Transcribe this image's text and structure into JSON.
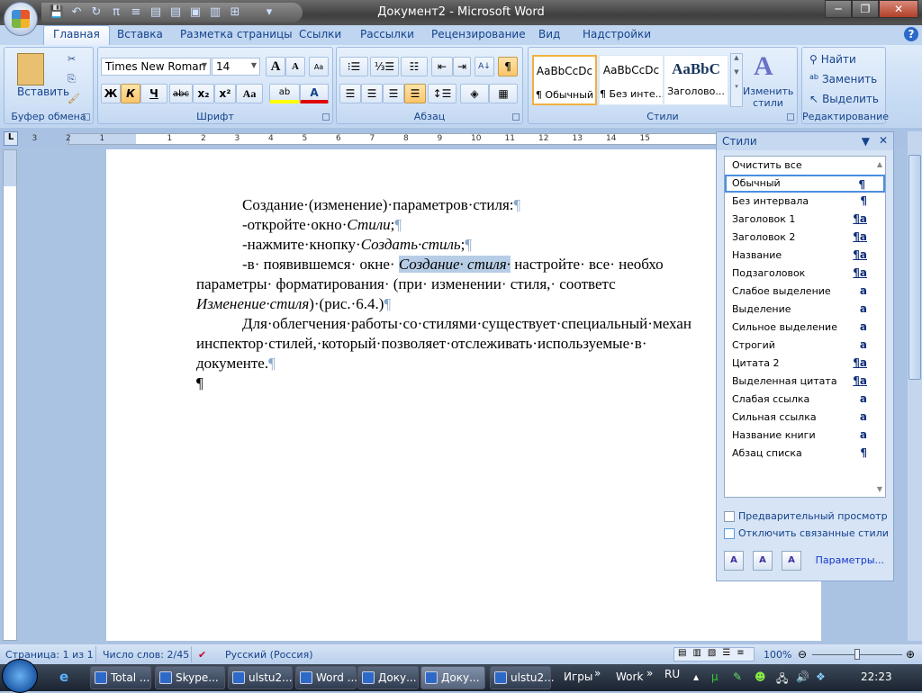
{
  "window": {
    "title": "Документ2 - Microsoft Word",
    "minimize": "─",
    "restore": "❐",
    "close": "✕"
  },
  "qat": [
    "save-icon",
    "undo-icon",
    "redo-icon",
    "pi-icon",
    "numbering-icon",
    "view-icon",
    "view-icon",
    "view-icon",
    "view-icon",
    "layout-icon",
    "customize-icon"
  ],
  "tabs": [
    "Главная",
    "Вставка",
    "Разметка страницы",
    "Ссылки",
    "Рассылки",
    "Рецензирование",
    "Вид",
    "Надстройки"
  ],
  "help": "?",
  "clipboard": {
    "paste": "Вставить",
    "label": "Буфер обмена"
  },
  "font": {
    "name": "Times New Roman",
    "size": "14",
    "label": "Шрифт",
    "bold": "Ж",
    "italic": "К",
    "underline": "Ч",
    "strike": "abc",
    "sub": "x₂",
    "sup": "x²",
    "case": "Aa",
    "grow": "A",
    "shrink": "A",
    "highlight": "ab",
    "color": "A",
    "highlight_color": "#ffff00",
    "font_color": "#e00000"
  },
  "paragraph": {
    "label": "Абзац",
    "pilcrow": "¶",
    "sort": "А↓"
  },
  "styles": {
    "label": "Стили",
    "gallery": [
      {
        "sample": "AaBbCcDc",
        "name": "¶ Обычный"
      },
      {
        "sample": "AaBbCcDc",
        "name": "¶ Без инте..."
      },
      {
        "sample": "AaBbC",
        "name": "Заголово..."
      }
    ],
    "change": "Изменить стили"
  },
  "editing": {
    "label": "Редактирование",
    "find": "Найти",
    "replace": "Заменить",
    "select": "Выделить"
  },
  "ruler": {
    "ticks": [
      "3",
      "2",
      "1",
      "1",
      "2",
      "3",
      "4",
      "5",
      "6",
      "7",
      "8",
      "9",
      "10",
      "11",
      "12",
      "13",
      "14",
      "15"
    ]
  },
  "document": {
    "l1": "Создание·(изменение)·параметров·стиля:",
    "l2a": "-откройте·окно·",
    "l2b": "Стили",
    ";": ";",
    "l3a": "-нажмите·кнопку·",
    "l3b": "Создать·стиль",
    "l4a": "-в·  появившемся·  окне·  ",
    "l4b": "Создание·  стиля·",
    "l4c": "  настройте·  все·  необхо",
    "l5": "параметры·   форматирования·   (при·   изменении·   стиля,·   соответс",
    "l6a": "Изменение·стиля",
    "l6b": ")·(рис.·6.4.)",
    "l7": "Для·облегчения·работы·со·стилями·существует·специальный·механ",
    "l8": "инспектор·стилей,·который·позволяет·отслеживать·используемые·в·",
    "l9": "документе.",
    "pm": "¶"
  },
  "pane": {
    "title": "Стили",
    "items": [
      {
        "name": "Очистить все",
        "icon": ""
      },
      {
        "name": "Обычный",
        "icon": "¶",
        "selected": true
      },
      {
        "name": "Без интервала",
        "icon": "¶"
      },
      {
        "name": "Заголовок 1",
        "icon": "¶a"
      },
      {
        "name": "Заголовок 2",
        "icon": "¶a"
      },
      {
        "name": "Название",
        "icon": "¶a"
      },
      {
        "name": "Подзаголовок",
        "icon": "¶a"
      },
      {
        "name": "Слабое выделение",
        "icon": "a"
      },
      {
        "name": "Выделение",
        "icon": "a"
      },
      {
        "name": "Сильное выделение",
        "icon": "a"
      },
      {
        "name": "Строгий",
        "icon": "a"
      },
      {
        "name": "Цитата 2",
        "icon": "¶a"
      },
      {
        "name": "Выделенная цитата",
        "icon": "¶a"
      },
      {
        "name": "Слабая ссылка",
        "icon": "a"
      },
      {
        "name": "Сильная ссылка",
        "icon": "a"
      },
      {
        "name": "Название книги",
        "icon": "a"
      },
      {
        "name": "Абзац списка",
        "icon": "¶"
      }
    ],
    "preview": "Предварительный просмотр",
    "preview_checked": false,
    "disable_linked": "Отключить связанные стили",
    "disable_linked_checked": false,
    "options": "Параметры..."
  },
  "status": {
    "page": "Страница: 1 из 1",
    "words": "Число слов: 2/45",
    "lang": "Русский (Россия)",
    "zoom": "100%",
    "zoom_value": 100
  },
  "taskbar": {
    "tasks": [
      "Total ...",
      "Skype...",
      "ulstu2...",
      "Word ...",
      "Доку...",
      "Доку...",
      "ulstu2..."
    ],
    "toolbars": [
      "Игры",
      "Work"
    ],
    "lang": "RU",
    "time": "22:23"
  }
}
